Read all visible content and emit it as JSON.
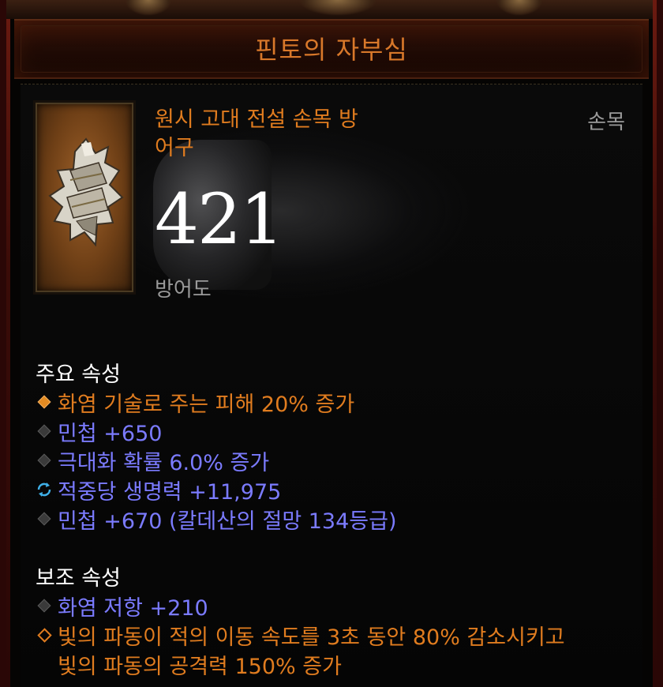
{
  "tooltip": {
    "item_title": "핀토의 자부심",
    "item_type_line1": "원시 고대 전설 손목 방",
    "item_type_line2": "어구",
    "slot": "손목",
    "armor_value": "421",
    "armor_label": "방어도",
    "primary": {
      "title": "주요 속성",
      "affixes": [
        {
          "icon": "orange-diamond-icon",
          "text": "화염 기술로 주는 피해 20% 증가"
        },
        {
          "icon": "gray-diamond-icon",
          "text": "민첩 +650"
        },
        {
          "icon": "gray-diamond-icon",
          "text": "극대화 확률 6.0% 증가"
        },
        {
          "icon": "enchant-cycle-icon",
          "text": "적중당 생명력 +11,975"
        },
        {
          "icon": "gray-diamond-icon",
          "text": "민첩 +670 (칼데산의 절망 134등급)"
        }
      ]
    },
    "secondary": {
      "title": "보조 속성",
      "affixes": [
        {
          "icon": "gray-diamond-icon",
          "text": "화염 저항 +210"
        },
        {
          "icon": "hollow-diamond-icon",
          "text": "빛의 파동이 적의 이동 속도를 3초 동안 80% 감소시키고",
          "continuation": "빛의 파동의 공격력 150% 증가"
        }
      ]
    },
    "colors": {
      "title": "#d8782a",
      "legendary": "#e07c1f",
      "magic": "#7b7bff",
      "label": "#9a9a9a"
    }
  }
}
